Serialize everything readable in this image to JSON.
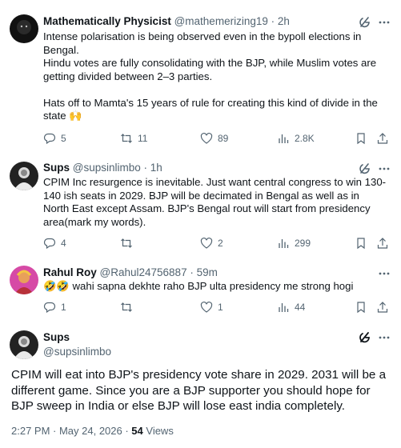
{
  "tweets": [
    {
      "name": "Mathematically Physicist",
      "handle": "@mathemerizing19",
      "time": "2h",
      "text": "Intense polarisation is being observed even in the bypoll elections in Bengal.\nHindu votes are fully consolidating with the BJP, while Muslim votes are getting divided between 2–3 parties.\n\nHats off to Mamta's 15 years of rule for creating this kind of divide in the state 🙌",
      "replies": "5",
      "reposts": "11",
      "likes": "89",
      "views": "2.8K"
    },
    {
      "name": "Sups",
      "handle": "@supsinlimbo",
      "time": "1h",
      "text": "CPIM Inc resurgence is inevitable. Just want central congress to win 130-140 ish seats in 2029. BJP will be decimated in Bengal as well as in North East except Assam. BJP's Bengal rout will start from presidency area(mark my words).",
      "replies": "4",
      "reposts": "",
      "likes": "2",
      "views": "299"
    },
    {
      "name": "Rahul Roy",
      "handle": "@Rahul24756887",
      "time": "59m",
      "text": "🤣🤣 wahi sapna dekhte raho BJP ulta presidency me strong hogi",
      "replies": "1",
      "reposts": "",
      "likes": "1",
      "views": "44"
    }
  ],
  "focus": {
    "name": "Sups",
    "handle": "@supsinlimbo",
    "text": "CPIM will eat into BJP's presidency vote share in 2029. 2031 will be a different game. Since you are a BJP supporter you should hope for BJP sweep in India or else BJP will lose east india completely.",
    "timestamp": "2:27 PM · May 24, 2026 · ",
    "views_count": "54",
    "views_label": " Views"
  },
  "sep": " · ",
  "colors": {
    "text": "#0f1419",
    "muted": "#536471",
    "border": "#eff3f4"
  },
  "icons": [
    "grok-icon",
    "more-icon",
    "reply-icon",
    "repost-icon",
    "like-icon",
    "views-icon",
    "bookmark-icon",
    "share-icon"
  ]
}
